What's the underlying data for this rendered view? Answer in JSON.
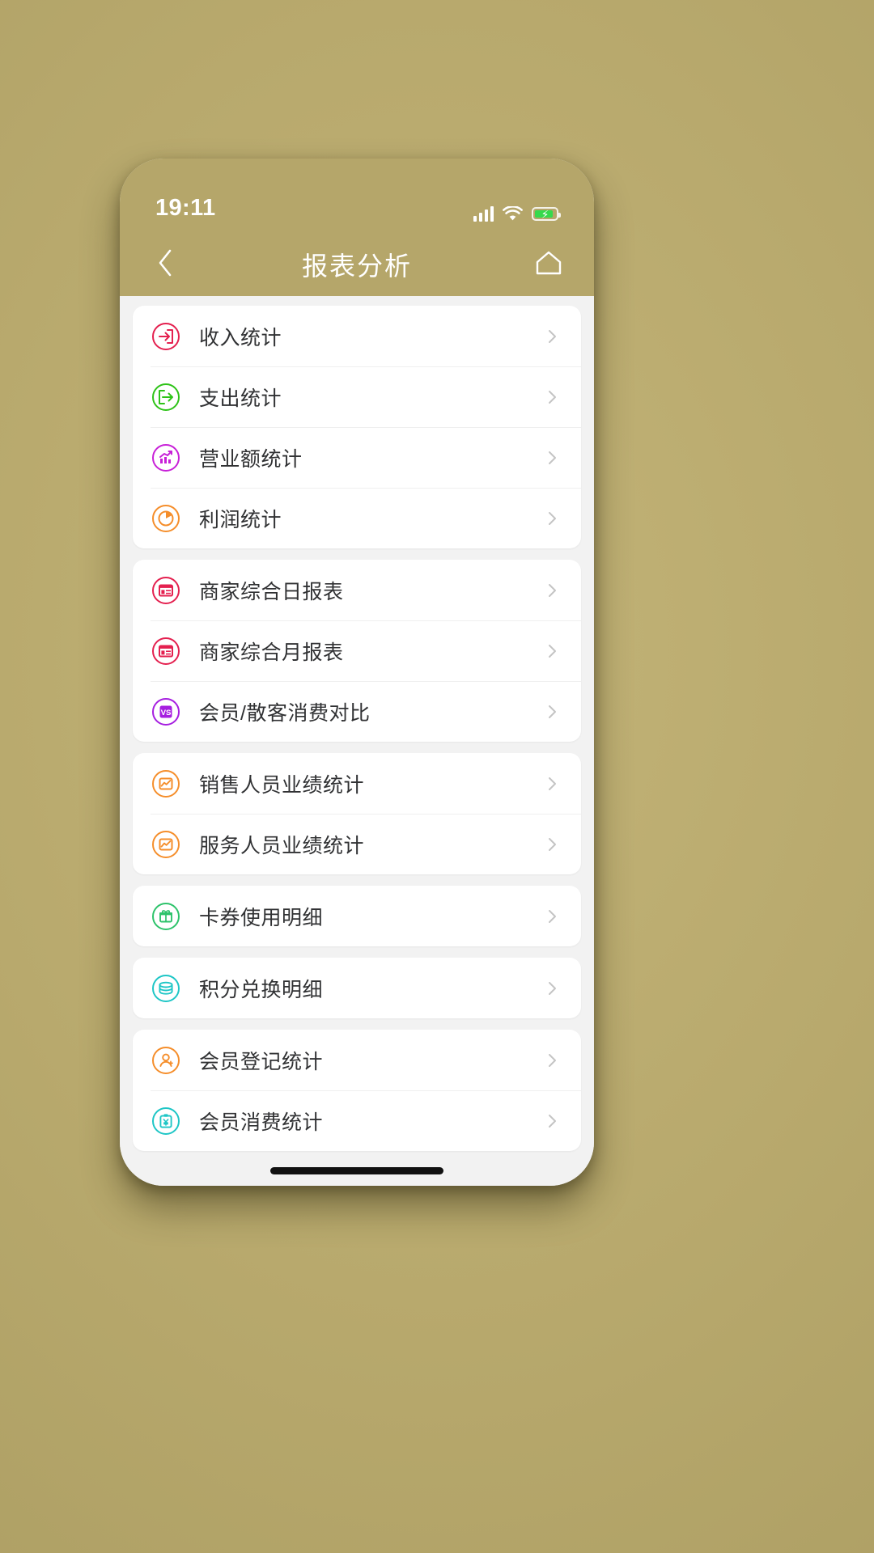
{
  "status_bar": {
    "time": "19:11",
    "signal_icon": "cellular-signal-icon",
    "wifi_icon": "wifi-icon",
    "battery_icon": "battery-charging-icon"
  },
  "nav_bar": {
    "back_icon": "chevron-left-icon",
    "title": "报表分析",
    "home_icon": "home-icon"
  },
  "colors": {
    "brand": "#b5a66a",
    "page_bg": "#f2f2f2",
    "card_bg": "#ffffff",
    "text": "#303133",
    "crimson": "#e4204f",
    "green": "#2ec318",
    "magenta": "#c820d8",
    "orange": "#f58e2b",
    "purple": "#a61fe0",
    "mint": "#2ec36b",
    "teal": "#1ec6c6"
  },
  "groups": [
    {
      "items": [
        {
          "label": "收入统计",
          "icon": "income-login-arrow-icon",
          "color": "#e4204f"
        },
        {
          "label": "支出统计",
          "icon": "expense-logout-arrow-icon",
          "color": "#2ec318"
        },
        {
          "label": "营业额统计",
          "icon": "bar-chart-trend-icon",
          "color": "#c820d8"
        },
        {
          "label": "利润统计",
          "icon": "pie-chart-icon",
          "color": "#f58e2b"
        }
      ]
    },
    {
      "items": [
        {
          "label": "商家综合日报表",
          "icon": "report-window-icon",
          "color": "#e4204f"
        },
        {
          "label": "商家综合月报表",
          "icon": "report-window-icon",
          "color": "#e4204f"
        },
        {
          "label": "会员/散客消费对比",
          "icon": "versus-compare-icon",
          "color": "#a61fe0"
        }
      ]
    },
    {
      "items": [
        {
          "label": "销售人员业绩统计",
          "icon": "performance-chart-frame-icon",
          "color": "#f58e2b"
        },
        {
          "label": "服务人员业绩统计",
          "icon": "performance-chart-frame-icon",
          "color": "#f58e2b"
        }
      ]
    },
    {
      "items": [
        {
          "label": "卡券使用明细",
          "icon": "voucher-gift-icon",
          "color": "#2ec36b"
        }
      ]
    },
    {
      "items": [
        {
          "label": "积分兑换明细",
          "icon": "coins-stack-icon",
          "color": "#1ec6c6"
        }
      ]
    },
    {
      "items": [
        {
          "label": "会员登记统计",
          "icon": "user-add-icon",
          "color": "#f58e2b"
        },
        {
          "label": "会员消费统计",
          "icon": "clipboard-yen-icon",
          "color": "#1ec6c6"
        }
      ]
    }
  ]
}
